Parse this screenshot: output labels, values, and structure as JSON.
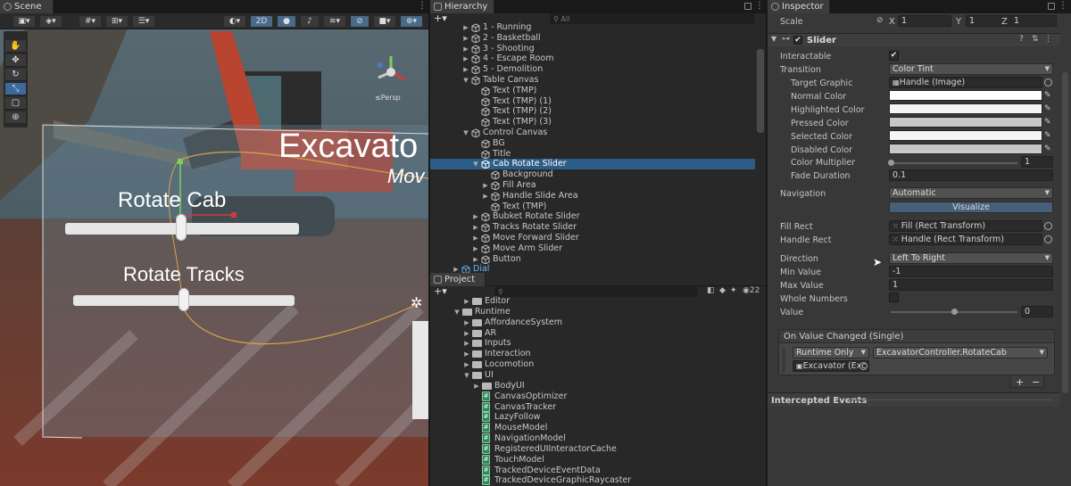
{
  "scene": {
    "tab": "Scene",
    "toolbar": {
      "mode_2d": "2D"
    },
    "overlay": {
      "title": "Excavato",
      "subtitle": "Mov",
      "rotate_cab": "Rotate Cab",
      "rotate_tracks": "Rotate Tracks",
      "persp": "≤Persp"
    }
  },
  "hierarchy": {
    "tab": "Hierarchy",
    "search_placeholder": "All",
    "rows": [
      {
        "label": "1 - Running",
        "depth": 2,
        "arrow": "▶"
      },
      {
        "label": "2 - Basketball",
        "depth": 2,
        "arrow": "▶"
      },
      {
        "label": "3 - Shooting",
        "depth": 2,
        "arrow": "▶"
      },
      {
        "label": "4 - Escape Room",
        "depth": 2,
        "arrow": "▶"
      },
      {
        "label": "5 - Demolition",
        "depth": 2,
        "arrow": "▶"
      },
      {
        "label": "Table Canvas",
        "depth": 2,
        "arrow": "▼"
      },
      {
        "label": "Text (TMP)",
        "depth": 3,
        "arrow": ""
      },
      {
        "label": "Text (TMP) (1)",
        "depth": 3,
        "arrow": ""
      },
      {
        "label": "Text (TMP) (2)",
        "depth": 3,
        "arrow": ""
      },
      {
        "label": "Text (TMP) (3)",
        "depth": 3,
        "arrow": ""
      },
      {
        "label": "Control Canvas",
        "depth": 2,
        "arrow": "▼"
      },
      {
        "label": "BG",
        "depth": 3,
        "arrow": ""
      },
      {
        "label": "Title",
        "depth": 3,
        "arrow": ""
      },
      {
        "label": "Cab Rotate Slider",
        "depth": 3,
        "arrow": "▼",
        "selected": true
      },
      {
        "label": "Background",
        "depth": 4,
        "arrow": ""
      },
      {
        "label": "Fill Area",
        "depth": 4,
        "arrow": "▶"
      },
      {
        "label": "Handle Slide Area",
        "depth": 4,
        "arrow": "▶"
      },
      {
        "label": "Text (TMP)",
        "depth": 4,
        "arrow": ""
      },
      {
        "label": "Bubket Rotate Slider",
        "depth": 3,
        "arrow": "▶"
      },
      {
        "label": "Tracks Rotate Slider",
        "depth": 3,
        "arrow": "▶"
      },
      {
        "label": "Move Forward Slider",
        "depth": 3,
        "arrow": "▶"
      },
      {
        "label": "Move Arm Slider",
        "depth": 3,
        "arrow": "▶"
      },
      {
        "label": "Button",
        "depth": 3,
        "arrow": "▶"
      },
      {
        "label": "Dial",
        "depth": 1,
        "arrow": "▶",
        "blue": true
      }
    ]
  },
  "project": {
    "tab": "Project",
    "hidden_count": "22",
    "rows": [
      {
        "label": "Editor",
        "depth": 1,
        "arrow": "▶",
        "kind": "folder"
      },
      {
        "label": "Runtime",
        "depth": 0,
        "arrow": "▼",
        "kind": "folder"
      },
      {
        "label": "AffordanceSystem",
        "depth": 1,
        "arrow": "▶",
        "kind": "folder"
      },
      {
        "label": "AR",
        "depth": 1,
        "arrow": "▶",
        "kind": "folder"
      },
      {
        "label": "Inputs",
        "depth": 1,
        "arrow": "▶",
        "kind": "folder"
      },
      {
        "label": "Interaction",
        "depth": 1,
        "arrow": "▶",
        "kind": "folder"
      },
      {
        "label": "Locomotion",
        "depth": 1,
        "arrow": "▶",
        "kind": "folder"
      },
      {
        "label": "UI",
        "depth": 1,
        "arrow": "▼",
        "kind": "folder"
      },
      {
        "label": "BodyUI",
        "depth": 2,
        "arrow": "▶",
        "kind": "folder"
      },
      {
        "label": "CanvasOptimizer",
        "depth": 2,
        "arrow": "",
        "kind": "script"
      },
      {
        "label": "CanvasTracker",
        "depth": 2,
        "arrow": "",
        "kind": "script"
      },
      {
        "label": "LazyFollow",
        "depth": 2,
        "arrow": "",
        "kind": "script"
      },
      {
        "label": "MouseModel",
        "depth": 2,
        "arrow": "",
        "kind": "script"
      },
      {
        "label": "NavigationModel",
        "depth": 2,
        "arrow": "",
        "kind": "script"
      },
      {
        "label": "RegisteredUIInteractorCache",
        "depth": 2,
        "arrow": "",
        "kind": "script"
      },
      {
        "label": "TouchModel",
        "depth": 2,
        "arrow": "",
        "kind": "script"
      },
      {
        "label": "TrackedDeviceEventData",
        "depth": 2,
        "arrow": "",
        "kind": "script"
      },
      {
        "label": "TrackedDeviceGraphicRaycaster",
        "depth": 2,
        "arrow": "",
        "kind": "script"
      }
    ]
  },
  "inspector": {
    "tab": "Inspector",
    "scale": {
      "label": "Scale",
      "x_label": "X",
      "x": "1",
      "y_label": "Y",
      "y": "1",
      "z_label": "Z",
      "z": "1"
    },
    "component": "Slider",
    "interactable": {
      "label": "Interactable",
      "check": "✔"
    },
    "transition": {
      "label": "Transition",
      "value": "Color Tint"
    },
    "target_graphic": {
      "label": "Target Graphic",
      "value": "Handle (Image)"
    },
    "normal_color": {
      "label": "Normal Color",
      "color": "#ffffff"
    },
    "highlighted_color": {
      "label": "Highlighted Color",
      "color": "#f5f5f5"
    },
    "pressed_color": {
      "label": "Pressed Color",
      "color": "#c8c8c8"
    },
    "selected_color": {
      "label": "Selected Color",
      "color": "#f5f5f5"
    },
    "disabled_color": {
      "label": "Disabled Color",
      "color": "#c8c8c8"
    },
    "color_multiplier": {
      "label": "Color Multiplier",
      "value": "1",
      "fraction": 0.0
    },
    "fade_duration": {
      "label": "Fade Duration",
      "value": "0.1"
    },
    "navigation": {
      "label": "Navigation",
      "value": "Automatic"
    },
    "visualize": "Visualize",
    "fill_rect": {
      "label": "Fill Rect",
      "value": "Fill (Rect Transform)"
    },
    "handle_rect": {
      "label": "Handle Rect",
      "value": "Handle (Rect Transform)"
    },
    "direction": {
      "label": "Direction",
      "value": "Left To Right"
    },
    "min_value": {
      "label": "Min Value",
      "value": "-1"
    },
    "max_value": {
      "label": "Max Value",
      "value": "1"
    },
    "whole_numbers": {
      "label": "Whole Numbers"
    },
    "value": {
      "label": "Value",
      "value": "0",
      "fraction": 0.5
    },
    "event": {
      "header": "On Value Changed (Single)",
      "runtime": "Runtime Only",
      "function": "ExcavatorController.RotateCab",
      "object": "Excavator (Exc"
    },
    "add_label": "+",
    "remove_label": "−",
    "intercepted": "Intercepted Events"
  }
}
